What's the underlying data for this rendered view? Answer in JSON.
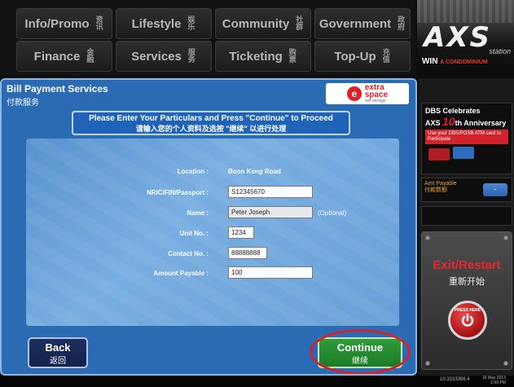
{
  "top_menu": {
    "items": [
      {
        "label": "Info/Promo",
        "zh": "资讯"
      },
      {
        "label": "Lifestyle",
        "zh": "娱乐"
      },
      {
        "label": "Community",
        "zh": "社群"
      },
      {
        "label": "Government",
        "zh": "政府"
      },
      {
        "label": "Finance",
        "zh": "金融"
      },
      {
        "label": "Services",
        "zh": "服务"
      },
      {
        "label": "Ticketing",
        "zh": "购票"
      },
      {
        "label": "Top-Up",
        "zh": "充值"
      }
    ]
  },
  "logo": {
    "brand": "AXS",
    "station": "station",
    "win": "WIN",
    "win_tagline": "A CONDOMINIUM"
  },
  "panel": {
    "title": "Bill Payment Services",
    "subtitle": "付款服务",
    "brand_badge": "e",
    "brand_name": "extra\nspace",
    "brand_sub": "self storage",
    "instruction_en": "Please Enter Your Particulars and Press \"Continue\" to Proceed",
    "instruction_zh": "请输入您的个人资料及选按 \"继续\" 以进行处理"
  },
  "form": {
    "location_label": "Location :",
    "location_value": "Boon Keng Road",
    "nric_label": "NRIC/FIN/Passport :",
    "nric_value": "S12345670",
    "name_label": "Name :",
    "name_value": "Peter Joseph",
    "name_optional": "(Optional)",
    "unit_label": "Unit No. :",
    "unit_value": "1234",
    "contact_label": "Contact No. :",
    "contact_value": "88888888",
    "amount_label": "Amount Payable :",
    "amount_value": "100"
  },
  "buttons": {
    "back_en": "Back",
    "back_zh": "返回",
    "continue_en": "Continue",
    "continue_zh": "继续"
  },
  "sidebar": {
    "promo_title": "DBS Celebrates",
    "promo_axs": "AXS",
    "promo_ten": "10",
    "promo_anniv": "th Anniversary",
    "promo_red": "Use your DBS/POSB ATM card to Participate",
    "amt_label": "Amt Payable",
    "amt_label_zh": "付款数额",
    "amt_button": "-",
    "exit_en": "Exit/Restart",
    "exit_zh": "重新开始",
    "press_here": "PRESS HERE"
  },
  "status": {
    "terminal_id": "10:3333356:4",
    "date": "16 May 2013",
    "time": "2:59 PM"
  }
}
